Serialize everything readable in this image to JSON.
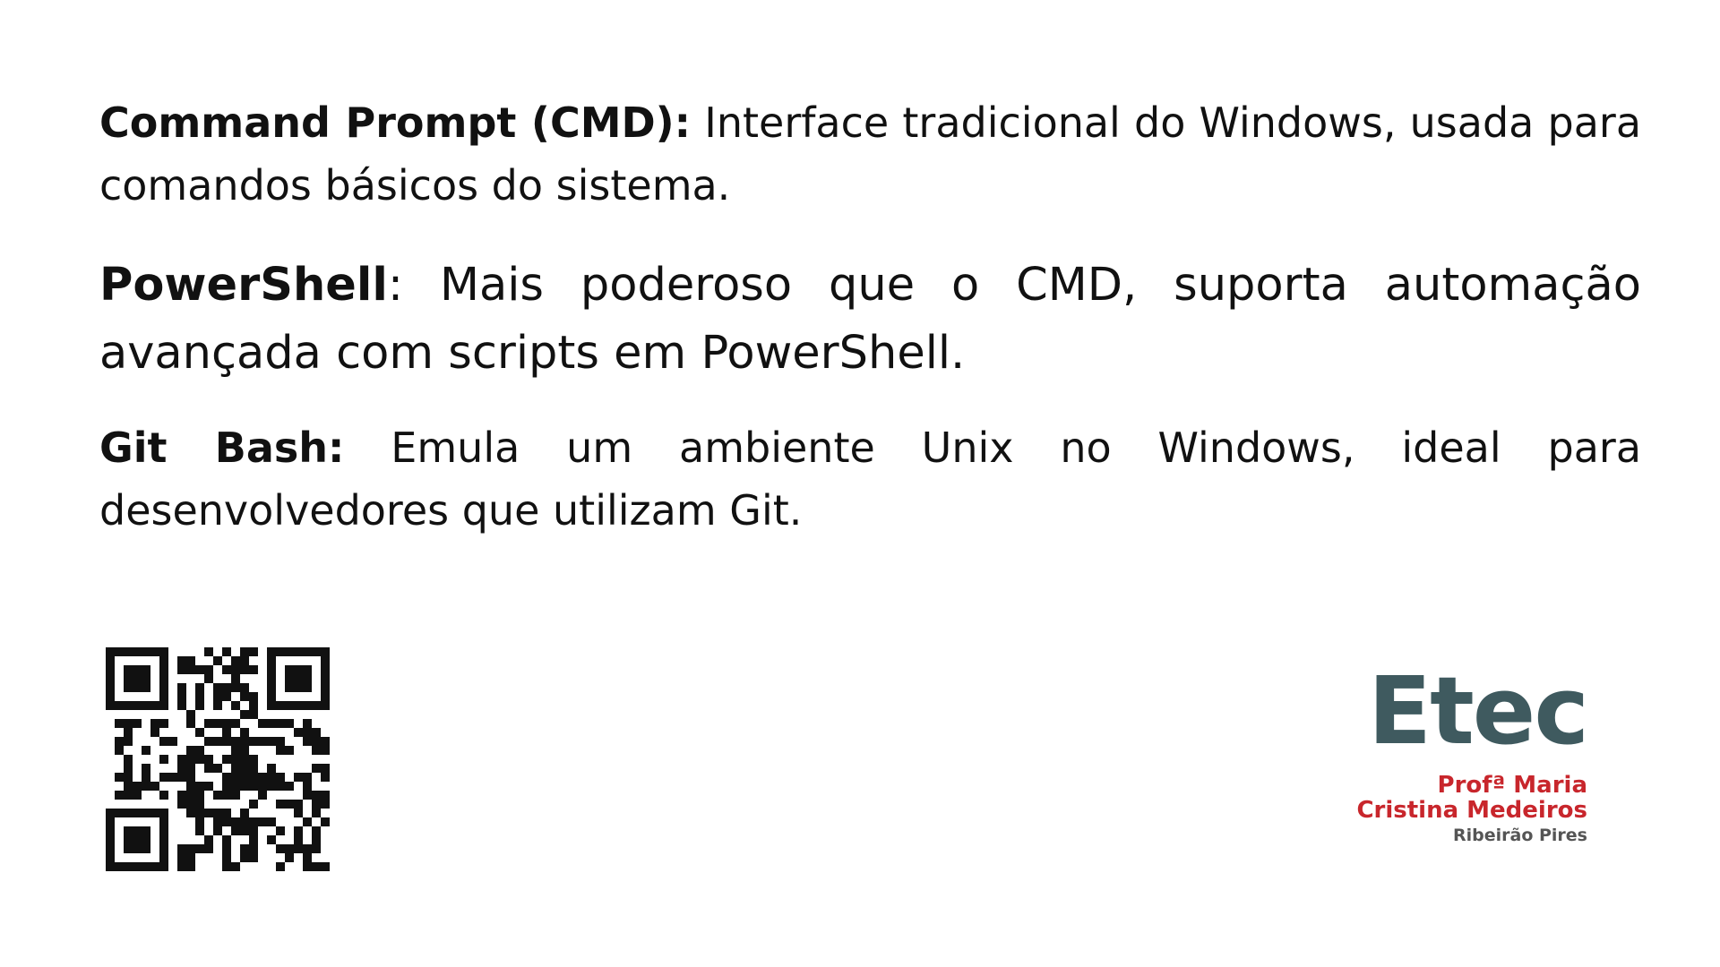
{
  "paragraphs": [
    {
      "term": "Command Prompt (CMD):",
      "text": " Interface tradicional do Windows, usada para comandos básicos do sistema."
    },
    {
      "term": "PowerShell",
      "text": ": Mais poderoso que o CMD, suporta automação avançada com scripts em PowerShell."
    },
    {
      "term": "Git Bash:",
      "text": " Emula um ambiente Unix no Windows, ideal para desenvolvedores que utilizam Git."
    }
  ],
  "qr_code": {
    "icon": "qr-code-icon"
  },
  "logo": {
    "wordmark": "Etec",
    "line1": "Profª Maria",
    "line2": "Cristina Medeiros",
    "line3": "Ribeirão Pires",
    "colors": {
      "wordmark": "#3f5a5f",
      "name": "#c8262c",
      "city": "#555555"
    }
  }
}
